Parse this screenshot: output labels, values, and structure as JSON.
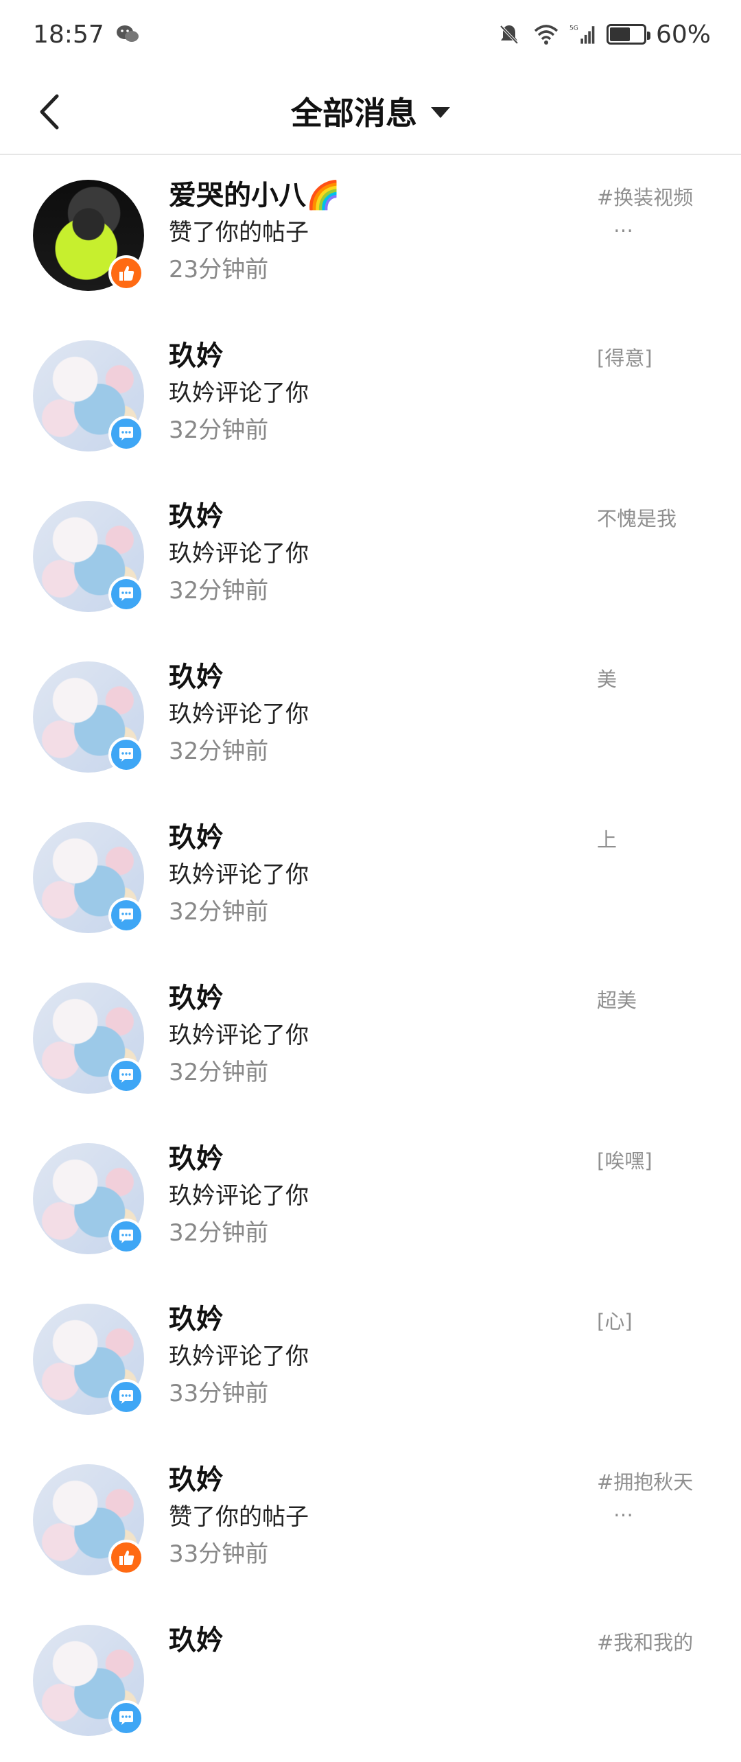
{
  "status": {
    "time": "18:57",
    "battery": "60%",
    "battery_level": 0.6,
    "network_label": "5G"
  },
  "header": {
    "title": "全部消息"
  },
  "messages": [
    {
      "name": "爱哭的小八🌈",
      "action": "赞了你的帖子",
      "time": "23分钟前",
      "type": "like",
      "avatar": "photo",
      "preview": "#换装视频",
      "preview_suffix": "…"
    },
    {
      "name": "玖妗",
      "action": "玖妗评论了你",
      "time": "32分钟前",
      "type": "comment",
      "avatar": "anime",
      "preview": "[得意]",
      "preview_suffix": ""
    },
    {
      "name": "玖妗",
      "action": "玖妗评论了你",
      "time": "32分钟前",
      "type": "comment",
      "avatar": "anime",
      "preview": "不愧是我",
      "preview_suffix": ""
    },
    {
      "name": "玖妗",
      "action": "玖妗评论了你",
      "time": "32分钟前",
      "type": "comment",
      "avatar": "anime",
      "preview": "美",
      "preview_suffix": ""
    },
    {
      "name": "玖妗",
      "action": "玖妗评论了你",
      "time": "32分钟前",
      "type": "comment",
      "avatar": "anime",
      "preview": "上",
      "preview_suffix": ""
    },
    {
      "name": "玖妗",
      "action": "玖妗评论了你",
      "time": "32分钟前",
      "type": "comment",
      "avatar": "anime",
      "preview": "超美",
      "preview_suffix": ""
    },
    {
      "name": "玖妗",
      "action": "玖妗评论了你",
      "time": "32分钟前",
      "type": "comment",
      "avatar": "anime",
      "preview": "[唉嘿]",
      "preview_suffix": ""
    },
    {
      "name": "玖妗",
      "action": "玖妗评论了你",
      "time": "33分钟前",
      "type": "comment",
      "avatar": "anime",
      "preview": "[心]",
      "preview_suffix": ""
    },
    {
      "name": "玖妗",
      "action": "赞了你的帖子",
      "time": "33分钟前",
      "type": "like",
      "avatar": "anime",
      "preview": "#拥抱秋天",
      "preview_suffix": "…"
    },
    {
      "name": "玖妗",
      "action": "",
      "time": "",
      "type": "comment",
      "avatar": "anime",
      "preview": "#我和我的",
      "preview_suffix": ""
    }
  ]
}
